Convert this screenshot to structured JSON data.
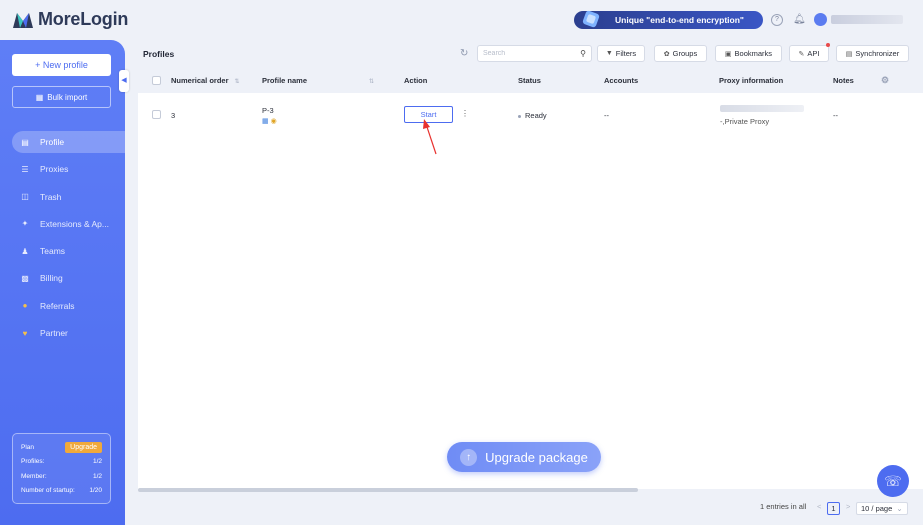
{
  "app": {
    "name": "MoreLogin"
  },
  "header": {
    "promo_text": "Unique \"end-to-end encryption\"",
    "help_icon": "question-circle-icon",
    "bell_icon": "bell-icon"
  },
  "sidebar": {
    "new_profile": "+ New profile",
    "bulk_import": "Bulk import",
    "items": [
      {
        "label": "Profile",
        "icon": "profile-icon",
        "active": true
      },
      {
        "label": "Proxies",
        "icon": "proxies-icon"
      },
      {
        "label": "Trash",
        "icon": "trash-icon"
      },
      {
        "label": "Extensions & Ap...",
        "icon": "puzzle-icon"
      },
      {
        "label": "Teams",
        "icon": "teams-icon"
      },
      {
        "label": "Billing",
        "icon": "billing-icon"
      },
      {
        "label": "Referrals",
        "icon": "referrals-icon"
      },
      {
        "label": "Partner",
        "icon": "heart-icon"
      }
    ],
    "plan": {
      "plan_label": "Plan",
      "upgrade": "Upgrade",
      "profiles_label": "Profiles:",
      "profiles_value": "1/2",
      "member_label": "Member:",
      "member_value": "1/2",
      "startup_label": "Number of startup:",
      "startup_value": "1/20"
    }
  },
  "main": {
    "title": "Profiles",
    "search_placeholder": "Search",
    "toolbar": {
      "filters": "Filters",
      "groups": "Groups",
      "bookmarks": "Bookmarks",
      "api": "API",
      "synchronizer": "Synchronizer"
    },
    "columns": {
      "order": "Numerical order",
      "name": "Profile name",
      "action": "Action",
      "status": "Status",
      "accounts": "Accounts",
      "proxy": "Proxy information",
      "notes": "Notes"
    },
    "rows": [
      {
        "order": "3",
        "name": "P-3",
        "action": "Start",
        "status": "Ready",
        "accounts": "--",
        "proxy": "-,Private Proxy",
        "notes": "--"
      }
    ],
    "upgrade_package": "Upgrade package",
    "pagination": {
      "entries": "1 entries in all",
      "current_page": "1",
      "per_page": "10 / page"
    }
  },
  "colors": {
    "accent": "#4d6cf0",
    "sidebar": "#5574f3",
    "upgrade_badge": "#f0a93b",
    "annotation_arrow": "#e8322f"
  }
}
